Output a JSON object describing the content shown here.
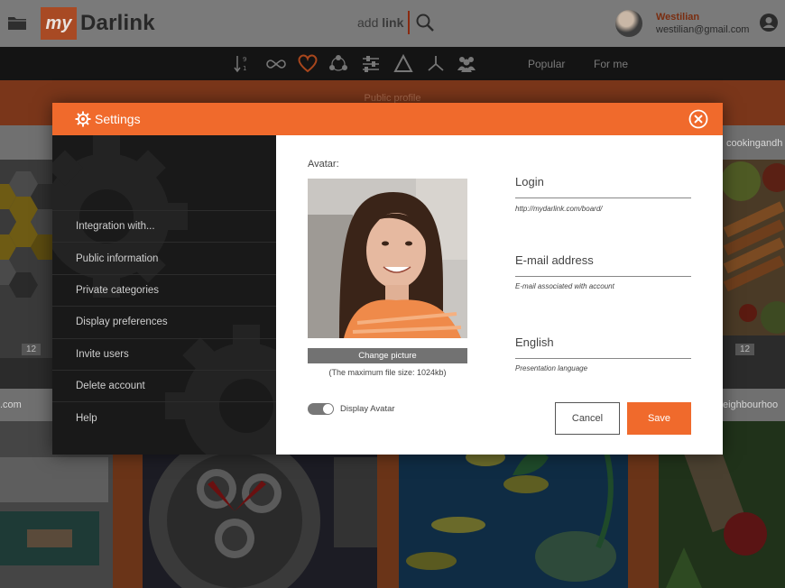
{
  "app": {
    "logo_mark": "my",
    "logo_text": "Darlink",
    "add_link_prefix": "add ",
    "add_link_bold": "link",
    "user_name": "Westilian",
    "user_email": "westilian@gmail.com"
  },
  "toolbar": {
    "icons": [
      "sort-icon",
      "infinity-icon",
      "heart-icon",
      "network-icon",
      "sliders-icon",
      "triangle-icon",
      "branch-icon",
      "group-icon"
    ],
    "tab_popular": "Popular",
    "tab_for_me": "For me"
  },
  "background": {
    "public_profile": "Public profile",
    "tail_right_top": "cookingandh",
    "tail_left": ".com",
    "tail_right": "eighbourhoo",
    "count_left": "12",
    "count_right": "12"
  },
  "modal": {
    "title": "Settings",
    "menu": [
      {
        "label": "Integration with..."
      },
      {
        "label": "Public information"
      },
      {
        "label": "Private categories"
      },
      {
        "label": "Display preferences"
      },
      {
        "label": "Invite users"
      },
      {
        "label": "Delete account"
      },
      {
        "label": "Help"
      }
    ],
    "avatar_label": "Avatar:",
    "change_picture": "Change picture",
    "max_file_size": "(The maximum file size: 1024kb)",
    "display_avatar": "Display Avatar",
    "display_avatar_on": true,
    "login_label": "Login",
    "login_hint": "http://mydarlink.com/board/",
    "email_label": "E-mail address",
    "email_hint": "E-mail associated with account",
    "language_value": "English",
    "language_hint": "Presentation  language",
    "cancel_label": "Cancel",
    "save_label": "Save"
  },
  "colors": {
    "accent": "#f06a2c",
    "dark_sidebar": "#191919",
    "overlay_orange": "#7a361a"
  }
}
